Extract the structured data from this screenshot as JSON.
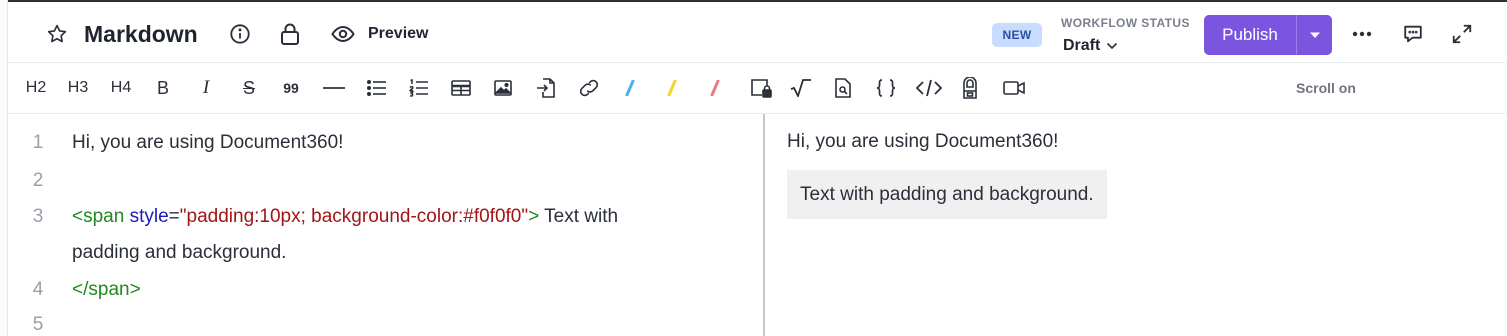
{
  "header": {
    "title": "Markdown",
    "preview_label": "Preview",
    "new_badge": "NEW",
    "workflow_label": "WORKFLOW STATUS",
    "workflow_value": "Draft",
    "publish_label": "Publish",
    "accent_color": "#7b55e0"
  },
  "toolbar": {
    "h2": "H2",
    "h3": "H3",
    "h4": "H4",
    "bold": "B",
    "italic": "I",
    "strike": "S",
    "quote": "99",
    "scroll_label": "Scroll on",
    "icons": [
      "horizontal-rule-icon",
      "bullet-list-icon",
      "numbered-list-icon",
      "table-icon",
      "image-icon",
      "import-icon",
      "link-icon",
      "blue-highlight-icon",
      "yellow-highlight-icon",
      "red-highlight-icon",
      "private-block-icon",
      "math-icon",
      "snippet-icon",
      "variable-icon",
      "code-icon",
      "glossary-icon",
      "video-icon"
    ]
  },
  "editor": {
    "line_numbers": [
      "1",
      "2",
      "3",
      "4",
      "5"
    ],
    "line1": "Hi, you are using Document360!",
    "line3_open": "<span",
    "line3_attr": "style",
    "line3_eq": "=",
    "line3_val": "\"padding:10px; background-color:#f0f0f0\"",
    "line3_close": ">",
    "line3_text": " Text with",
    "line3_wrap": "padding and background.",
    "line4": "</span>"
  },
  "preview": {
    "line1": "Hi, you are using Document360!",
    "box_text": "Text with padding and background."
  }
}
